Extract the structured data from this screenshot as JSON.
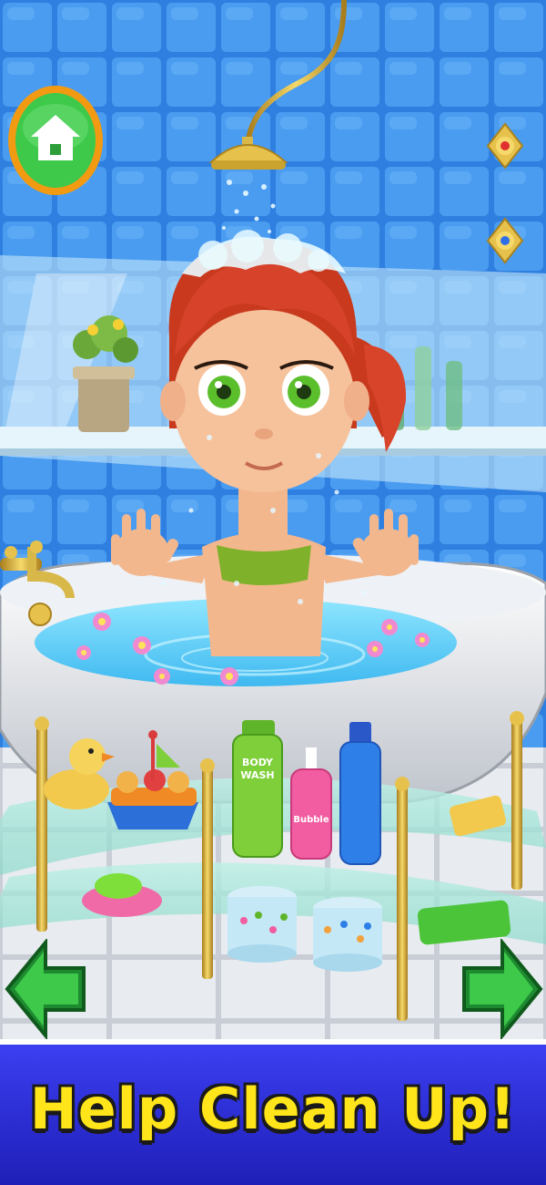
{
  "banner": {
    "text": "Help Clean Up!"
  },
  "products": {
    "body_wash_label_line1": "BODY",
    "body_wash_label_line2": "WASH",
    "bubble_label": "Bubble"
  },
  "colors": {
    "tile_blue": "#3a8ce8",
    "banner_blue": "#2323c8",
    "banner_text": "#ffe51a",
    "button_green": "#3ec94a",
    "button_ring": "#f29a12",
    "gold": "#d9b84a"
  },
  "icons": {
    "home": "house-icon",
    "back": "arrow-left-icon",
    "next": "arrow-right-icon",
    "valve": "faucet-valve-icon"
  }
}
